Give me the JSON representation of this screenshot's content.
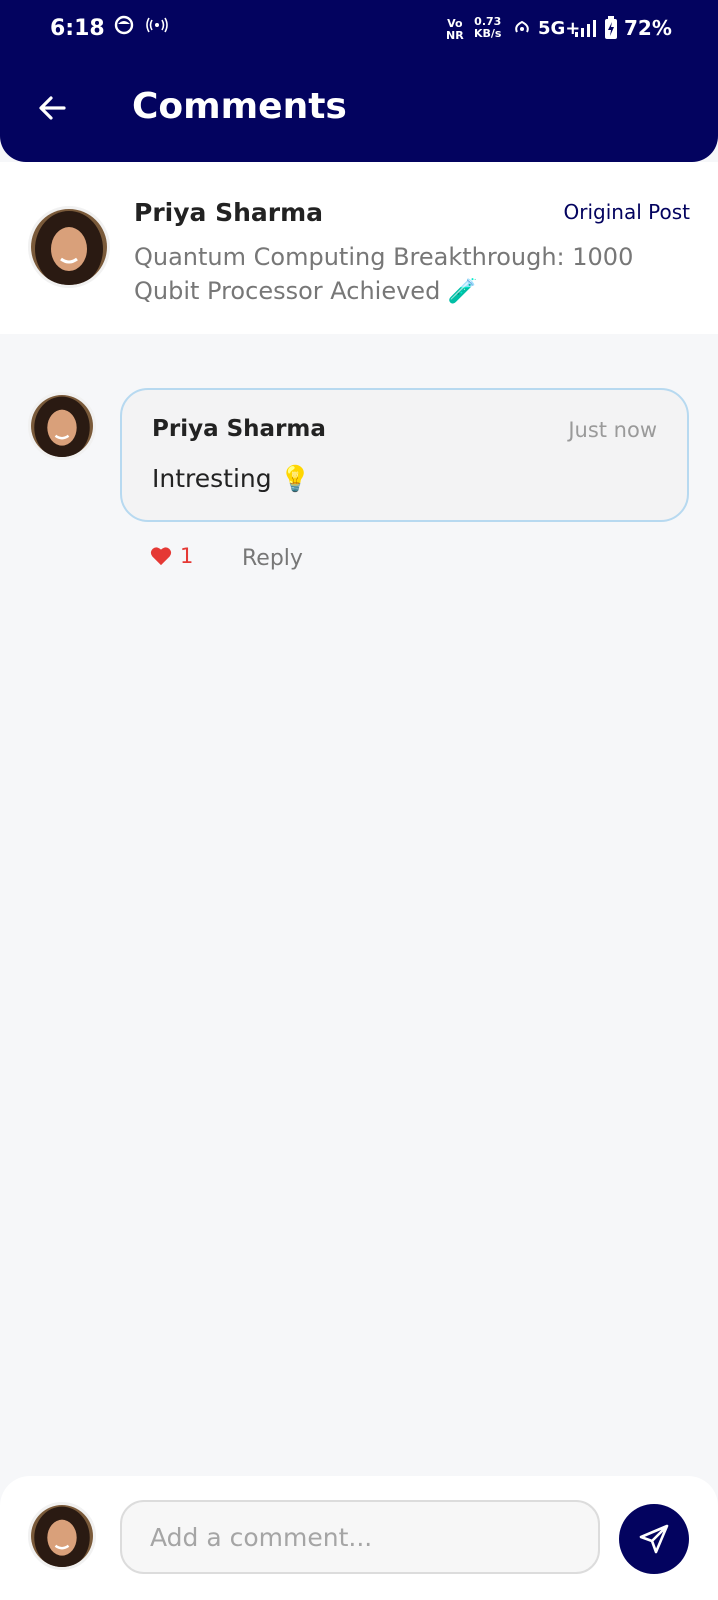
{
  "status_bar": {
    "time": "6:18",
    "network_top": "Vo",
    "network_bottom": "NR",
    "speed_value": "0.73",
    "speed_unit": "KB/s",
    "network_type": "5G+",
    "battery": "72%"
  },
  "header": {
    "title": "Comments",
    "back_icon": "arrow-left-icon"
  },
  "post": {
    "author": "Priya Sharma",
    "badge": "Original Post",
    "text": "Quantum Computing Breakthrough: 1000 Qubit Processor Achieved 🧪"
  },
  "comments": [
    {
      "author": "Priya Sharma",
      "time": "Just now",
      "text": "Intresting 💡",
      "likes": "1",
      "reply_label": "Reply"
    }
  ],
  "composer": {
    "placeholder": "Add a comment...",
    "value": ""
  },
  "colors": {
    "header_bg": "#03035f",
    "like": "#e53935",
    "bubble_border": "#b7d9f0"
  }
}
